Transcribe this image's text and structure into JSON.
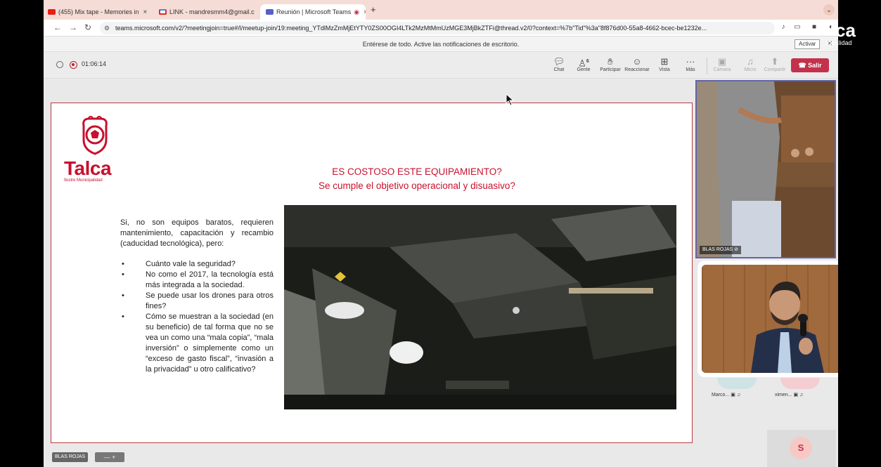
{
  "browser": {
    "tabs": [
      {
        "label": "(455) Mix tape - Memories in",
        "favicon": "youtube-icon"
      },
      {
        "label": "LINK - mandresmm4@gmail.c",
        "favicon": "gmail-icon"
      },
      {
        "label": "Reunión | Microsoft Teams",
        "favicon": "teams-icon"
      }
    ],
    "url": "teams.microsoft.com/v2/?meetingjoin=true#/l/meetup-join/19:meeting_YTdlMzZmMjEtYTY0ZS00OGI4LTk2MzMtMmUzMGE3MjBkZTFi@thread.v2/0?context=%7b\"Tid\"%3a\"8f876d00-55a8-4662-bcec-be1232e..."
  },
  "notification": {
    "text": "Entérese de todo. Active las notificaciones de escritorio.",
    "activate_label": "Activar"
  },
  "meeting": {
    "timer": "01:06:14",
    "toolbar": [
      {
        "label": "Chat",
        "icon": "chat-icon",
        "enabled": true
      },
      {
        "label": "Gente",
        "icon": "people-icon",
        "enabled": true,
        "badge": "6"
      },
      {
        "label": "Participar",
        "icon": "raise-hand-icon",
        "enabled": true
      },
      {
        "label": "Reaccionar",
        "icon": "smiley-icon",
        "enabled": true
      },
      {
        "label": "Vista",
        "icon": "grid-icon",
        "enabled": true
      },
      {
        "label": "Más",
        "icon": "more-icon",
        "enabled": true
      },
      {
        "label": "Cámara",
        "icon": "camera-off-icon",
        "enabled": false
      },
      {
        "label": "Micro",
        "icon": "mic-off-icon",
        "enabled": false
      },
      {
        "label": "Compartir",
        "icon": "share-icon",
        "enabled": false
      }
    ],
    "leave_label": "Salir"
  },
  "slide": {
    "logo_name": "Talca",
    "logo_sub": "Ilustre Municipalidad",
    "title_line1": "ES COSTOSO ESTE EQUIPAMIENTO?",
    "title_line2": "Se cumple el objetivo operacional y disuasivo?",
    "intro": "Si, no son equipos baratos, requieren mantenimiento, capacitación y recambio (caducidad tecnológica), pero:",
    "bullets": [
      "Cuánto vale la seguridad?",
      "No como el 2017, la tecnología está más integrada a la sociedad.",
      "Se puede usar los drones para otros fines?",
      "Cómo se muestran a la sociedad (en su beneficio) de tal forma que no se vea un como una “mala copia”, “mala inversión” o simplemente como un “exceso de gasto fiscal”, “invasión a la privacidad” u otro calificativo?"
    ]
  },
  "participants": {
    "top_tile_name": "BLAS ROJAS",
    "mini": [
      {
        "name": "Marco...",
        "color": "#cfe3e6"
      },
      {
        "name": "ximen...",
        "color": "#f4cdd0"
      }
    ],
    "self_initial": "S"
  },
  "bottom": {
    "stage_name": "BLAS ROJAS",
    "zoom_minus": "—",
    "zoom_plus": "+"
  },
  "watermark": {
    "big": "ca",
    "small": "icipalidad"
  },
  "colors": {
    "accent": "#c8102e",
    "teams": "#6264a7",
    "leave": "#c4314b"
  }
}
